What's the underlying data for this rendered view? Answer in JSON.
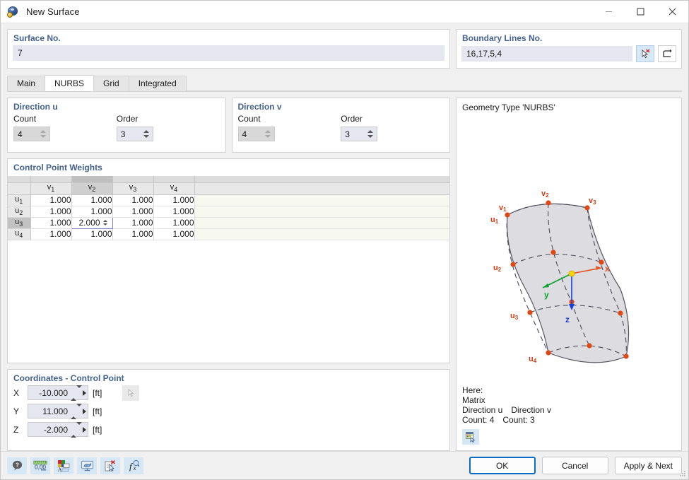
{
  "window": {
    "title": "New Surface",
    "icon": "surface-app-icon",
    "controls": {
      "minimize": "─",
      "maximize": "□",
      "close": "✕"
    }
  },
  "surface": {
    "label": "Surface No.",
    "value": "7"
  },
  "boundary": {
    "label": "Boundary Lines No.",
    "value": "16,17,5,4",
    "pick_icon": "select-lines-icon",
    "reverse_icon": "reverse-orientation-icon"
  },
  "tabs": [
    {
      "label": "Main",
      "active": false
    },
    {
      "label": "NURBS",
      "active": true
    },
    {
      "label": "Grid",
      "active": false
    },
    {
      "label": "Integrated",
      "active": false
    }
  ],
  "direction_u": {
    "title": "Direction u",
    "count_label": "Count",
    "count_value": "4",
    "order_label": "Order",
    "order_value": "3"
  },
  "direction_v": {
    "title": "Direction v",
    "count_label": "Count",
    "count_value": "4",
    "order_label": "Order",
    "order_value": "3"
  },
  "weights": {
    "title": "Control Point Weights",
    "columns": [
      "v1",
      "v2",
      "v3",
      "v4"
    ],
    "rows": [
      {
        "header": "u1",
        "values": [
          "1.000",
          "1.000",
          "1.000",
          "1.000"
        ]
      },
      {
        "header": "u2",
        "values": [
          "1.000",
          "1.000",
          "1.000",
          "1.000"
        ]
      },
      {
        "header": "u3",
        "values": [
          "1.000",
          "2.000",
          "1.000",
          "1.000"
        ]
      },
      {
        "header": "u4",
        "values": [
          "1.000",
          "1.000",
          "1.000",
          "1.000"
        ]
      }
    ],
    "active_cell": {
      "row": 2,
      "col": 1,
      "value": "2.000"
    }
  },
  "coordinates": {
    "title": "Coordinates - Control Point",
    "unit": "[ft]",
    "fields": [
      {
        "label": "X",
        "value": "-10.000"
      },
      {
        "label": "Y",
        "value": "11.000"
      },
      {
        "label": "Z",
        "value": "-2.000"
      }
    ],
    "pick_icon": "pick-point-icon"
  },
  "preview": {
    "geometry_type": "Geometry Type 'NURBS'",
    "info_here": "Here:",
    "info_matrix": "Matrix",
    "info_dir_u": "Direction u",
    "info_dir_v": "Direction v",
    "info_count_u": "Count: 4",
    "info_count_v": "Count: 3",
    "table_icon": "matrix-table-icon",
    "axes": {
      "x": "x",
      "y": "y",
      "z": "z"
    },
    "u_labels": [
      "u1",
      "u2",
      "u3",
      "u4"
    ],
    "v_labels": [
      "v1",
      "v2",
      "v3"
    ],
    "colors": {
      "axis_x": "#e8501e",
      "axis_y": "#0aa02c",
      "axis_z": "#1540d8",
      "control_point": "#e04713",
      "origin": "#ffd400",
      "surface_fill": "#dcdce1",
      "surface_edge": "#4a4a5a"
    }
  },
  "toolbar": [
    {
      "name": "help-icon",
      "label": "?"
    },
    {
      "name": "decimal-places-icon",
      "label": "0,00"
    },
    {
      "name": "colors-fonts-icon",
      "label": ""
    },
    {
      "name": "display-properties-icon",
      "label": ""
    },
    {
      "name": "clear-selection-icon",
      "label": ""
    },
    {
      "name": "formula-icon",
      "label": "f"
    }
  ],
  "footer": {
    "ok": "OK",
    "cancel": "Cancel",
    "apply_next": "Apply & Next"
  }
}
